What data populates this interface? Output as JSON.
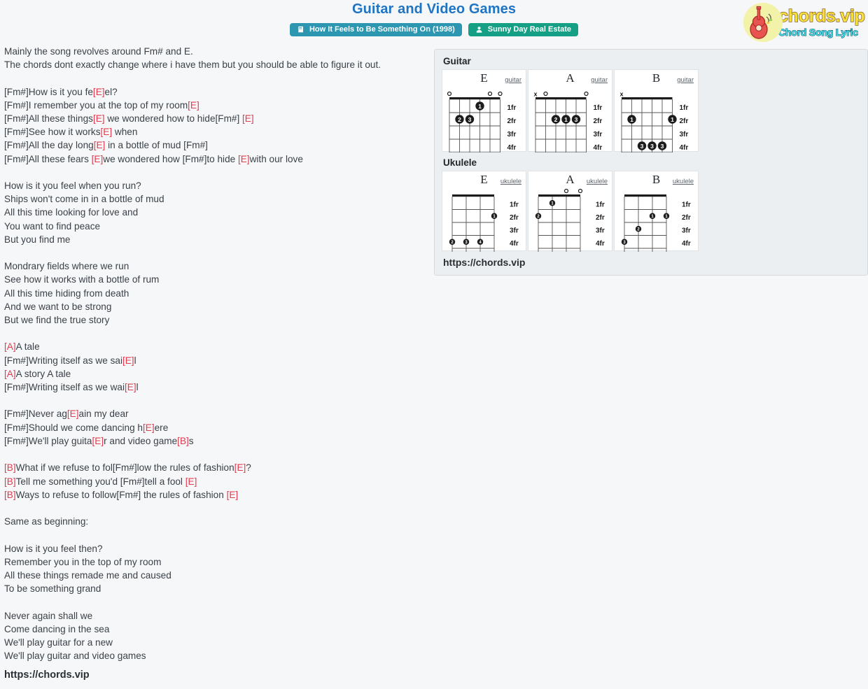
{
  "header": {
    "title": "Guitar and Video Games",
    "badges": [
      {
        "label": "How It Feels to Be Something On (1998)",
        "icon": "book-icon",
        "color": "#2d96b0",
        "type": "album"
      },
      {
        "label": "Sunny Day Real Estate",
        "icon": "user-icon",
        "color": "#15a085",
        "type": "artist"
      }
    ]
  },
  "logo": {
    "icon": "guitar-icon",
    "wordmark": "chords.vip",
    "tagline": "Chord Song Lyric",
    "wordmark_color": "#f5e03d",
    "tagline_color": "#43e0e8",
    "disc_color": "#f2f2a8"
  },
  "lyrics": {
    "chord_color": "#e23b4e",
    "text_color": "#3b4148",
    "lines": [
      [
        {
          "t": "Mainly the song revolves around Fm# and E.",
          "c": false
        }
      ],
      [
        {
          "t": "The chords dont exactly change where i have them but you should be able to figure it out.",
          "c": false
        }
      ],
      [],
      [
        {
          "t": "[Fm#]How is it you fe",
          "c": false
        },
        {
          "t": "[E]",
          "c": true
        },
        {
          "t": "el?",
          "c": false
        }
      ],
      [
        {
          "t": "[Fm#]I remember you at the top of my room",
          "c": false
        },
        {
          "t": "[E]",
          "c": true
        }
      ],
      [
        {
          "t": "[Fm#]All these things",
          "c": false
        },
        {
          "t": "[E]",
          "c": true
        },
        {
          "t": " we wondered how to hide[Fm#] ",
          "c": false
        },
        {
          "t": "[E]",
          "c": true
        }
      ],
      [
        {
          "t": "[Fm#]See how it works",
          "c": false
        },
        {
          "t": "[E]",
          "c": true
        },
        {
          "t": " when",
          "c": false
        }
      ],
      [
        {
          "t": "[Fm#]All the day long",
          "c": false
        },
        {
          "t": "[E]",
          "c": true
        },
        {
          "t": " in a bottle of mud [Fm#]",
          "c": false
        }
      ],
      [
        {
          "t": "[Fm#]All these fears ",
          "c": false
        },
        {
          "t": "[E]",
          "c": true
        },
        {
          "t": "we wondered how [Fm#]to hide ",
          "c": false
        },
        {
          "t": "[E]",
          "c": true
        },
        {
          "t": "with our love",
          "c": false
        }
      ],
      [],
      [
        {
          "t": "How is it you feel when you run?",
          "c": false
        }
      ],
      [
        {
          "t": "Ships won't come in in a bottle of mud",
          "c": false
        }
      ],
      [
        {
          "t": "All this time looking for love and",
          "c": false
        }
      ],
      [
        {
          "t": "You want to find peace",
          "c": false
        }
      ],
      [
        {
          "t": "But you find me",
          "c": false
        }
      ],
      [],
      [
        {
          "t": "Mondrary fields where we run",
          "c": false
        }
      ],
      [
        {
          "t": "See how it works with a bottle of rum",
          "c": false
        }
      ],
      [
        {
          "t": "All this time hiding from death",
          "c": false
        }
      ],
      [
        {
          "t": "And we want to be strong",
          "c": false
        }
      ],
      [
        {
          "t": "But we find the true story",
          "c": false
        }
      ],
      [],
      [
        {
          "t": "[A]",
          "c": true
        },
        {
          "t": "A tale",
          "c": false
        }
      ],
      [
        {
          "t": "[Fm#]Writing itself as we sai",
          "c": false
        },
        {
          "t": "[E]",
          "c": true
        },
        {
          "t": "l",
          "c": false
        }
      ],
      [
        {
          "t": "[A]",
          "c": true
        },
        {
          "t": "A story A tale",
          "c": false
        }
      ],
      [
        {
          "t": "[Fm#]Writing itself as we wai",
          "c": false
        },
        {
          "t": "[E]",
          "c": true
        },
        {
          "t": "l",
          "c": false
        }
      ],
      [],
      [
        {
          "t": "[Fm#]Never ag",
          "c": false
        },
        {
          "t": "[E]",
          "c": true
        },
        {
          "t": "ain my dear",
          "c": false
        }
      ],
      [
        {
          "t": "[Fm#]Should we come dancing h",
          "c": false
        },
        {
          "t": "[E]",
          "c": true
        },
        {
          "t": "ere",
          "c": false
        }
      ],
      [
        {
          "t": "[Fm#]We'll play guita",
          "c": false
        },
        {
          "t": "[E]",
          "c": true
        },
        {
          "t": "r and video game",
          "c": false
        },
        {
          "t": "[B]",
          "c": true
        },
        {
          "t": "s",
          "c": false
        }
      ],
      [],
      [
        {
          "t": "[B]",
          "c": true
        },
        {
          "t": "What if we refuse to fol[Fm#]low the rules of fashion",
          "c": false
        },
        {
          "t": "[E]",
          "c": true
        },
        {
          "t": "?",
          "c": false
        }
      ],
      [
        {
          "t": "[B]",
          "c": true
        },
        {
          "t": "Tell me something you'd [Fm#]tell a fool ",
          "c": false
        },
        {
          "t": "[E]",
          "c": true
        }
      ],
      [
        {
          "t": "[B]",
          "c": true
        },
        {
          "t": "Ways to refuse to follow[Fm#] the rules of fashion ",
          "c": false
        },
        {
          "t": "[E]",
          "c": true
        }
      ],
      [],
      [
        {
          "t": "Same as beginning:",
          "c": false
        }
      ],
      [],
      [
        {
          "t": "How is it you feel then?",
          "c": false
        }
      ],
      [
        {
          "t": "Remember you in the top of my room",
          "c": false
        }
      ],
      [
        {
          "t": "All these things remade me and caused",
          "c": false
        }
      ],
      [
        {
          "t": "To be something grand",
          "c": false
        }
      ],
      [],
      [
        {
          "t": "Never again shall we",
          "c": false
        }
      ],
      [
        {
          "t": "Come dancing in the sea",
          "c": false
        }
      ],
      [
        {
          "t": "We'll play guitar for a new",
          "c": false
        }
      ],
      [
        {
          "t": "We'll play guitar and video games",
          "c": false
        }
      ]
    ],
    "footer_url": "https://chords.vip"
  },
  "chord_panel": {
    "guitar_heading": "Guitar",
    "ukulele_heading": "Ukulele",
    "panel_url": "https://chords.vip",
    "fret_labels": [
      "1fr",
      "2fr",
      "3fr",
      "4fr"
    ],
    "guitar_chords": [
      {
        "name": "E",
        "type_label": "guitar",
        "strings": 6,
        "top_markers": [
          "o",
          "",
          "",
          "",
          "o",
          "o"
        ],
        "dots": [
          {
            "string": 3,
            "fret": 1,
            "finger": "1"
          },
          {
            "string": 5,
            "fret": 2,
            "finger": "2"
          },
          {
            "string": 4,
            "fret": 2,
            "finger": "3"
          }
        ]
      },
      {
        "name": "A",
        "type_label": "guitar",
        "strings": 6,
        "top_markers": [
          "x",
          "o",
          "",
          "",
          "",
          "o"
        ],
        "dots": [
          {
            "string": 4,
            "fret": 2,
            "finger": "2"
          },
          {
            "string": 3,
            "fret": 2,
            "finger": "1"
          },
          {
            "string": 2,
            "fret": 2,
            "finger": "3"
          }
        ]
      },
      {
        "name": "B",
        "type_label": "guitar",
        "strings": 6,
        "top_markers": [
          "x",
          "",
          "",
          "",
          "",
          ""
        ],
        "dots": [
          {
            "string": 5,
            "fret": 2,
            "finger": "1"
          },
          {
            "string": 1,
            "fret": 2,
            "finger": "1"
          },
          {
            "string": 4,
            "fret": 4,
            "finger": "3"
          },
          {
            "string": 3,
            "fret": 4,
            "finger": "3"
          },
          {
            "string": 2,
            "fret": 4,
            "finger": "3"
          }
        ]
      }
    ],
    "ukulele_chords": [
      {
        "name": "E",
        "type_label": "ukulele",
        "strings": 4,
        "top_markers": [
          "",
          "",
          "",
          ""
        ],
        "dots": [
          {
            "string": 1,
            "fret": 2,
            "finger": "1"
          },
          {
            "string": 4,
            "fret": 4,
            "finger": "2"
          },
          {
            "string": 3,
            "fret": 4,
            "finger": "3"
          },
          {
            "string": 2,
            "fret": 4,
            "finger": "4"
          }
        ]
      },
      {
        "name": "A",
        "type_label": "ukulele",
        "strings": 4,
        "top_markers": [
          "",
          "",
          "o",
          "o"
        ],
        "dots": [
          {
            "string": 3,
            "fret": 1,
            "finger": "1"
          },
          {
            "string": 4,
            "fret": 2,
            "finger": "2"
          }
        ]
      },
      {
        "name": "B",
        "type_label": "ukulele",
        "strings": 4,
        "top_markers": [
          "",
          "",
          "",
          ""
        ],
        "dots": [
          {
            "string": 2,
            "fret": 2,
            "finger": "1"
          },
          {
            "string": 1,
            "fret": 2,
            "finger": "1"
          },
          {
            "string": 3,
            "fret": 3,
            "finger": "2"
          },
          {
            "string": 4,
            "fret": 4,
            "finger": "3"
          }
        ]
      }
    ]
  }
}
